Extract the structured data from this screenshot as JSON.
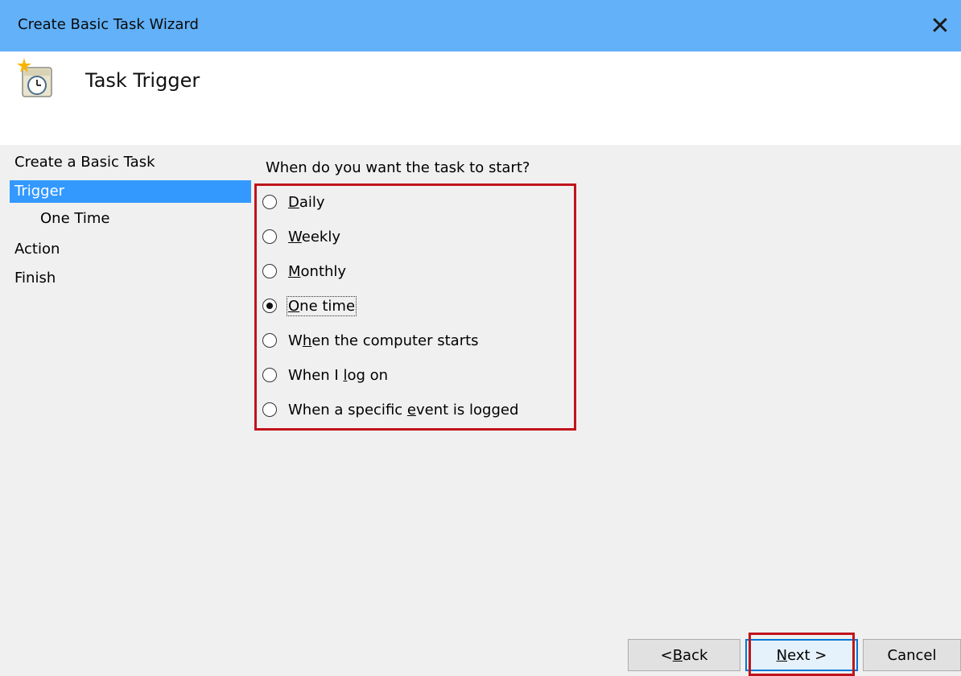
{
  "window": {
    "title": "Create Basic Task Wizard",
    "close_icon": "close-icon"
  },
  "header": {
    "icon": "scheduled-task-clock-icon",
    "title": "Task Trigger"
  },
  "nav": {
    "items": [
      {
        "label": "Create a Basic Task",
        "active": false,
        "sub": false
      },
      {
        "label": "Trigger",
        "active": true,
        "sub": false
      },
      {
        "label": "One Time",
        "active": false,
        "sub": true
      },
      {
        "label": "Action",
        "active": false,
        "sub": false
      },
      {
        "label": "Finish",
        "active": false,
        "sub": false
      }
    ]
  },
  "trigger": {
    "question": "When do you want the task to start?",
    "options": [
      {
        "pre": "",
        "key": "D",
        "post": "aily",
        "checked": false
      },
      {
        "pre": "",
        "key": "W",
        "post": "eekly",
        "checked": false
      },
      {
        "pre": "",
        "key": "M",
        "post": "onthly",
        "checked": false
      },
      {
        "pre": "",
        "key": "O",
        "post": "ne time",
        "checked": true
      },
      {
        "pre": "W",
        "key": "h",
        "post": "en the computer starts",
        "checked": false
      },
      {
        "pre": "When I ",
        "key": "l",
        "post": "og on",
        "checked": false
      },
      {
        "pre": "When a specific ",
        "key": "e",
        "post": "vent is logged",
        "checked": false
      }
    ],
    "highlight_color": "#c0141c"
  },
  "buttons": {
    "back": {
      "pre": "< ",
      "key": "B",
      "post": "ack"
    },
    "next": {
      "pre": "",
      "key": "N",
      "post": "ext >"
    },
    "cancel": "Cancel"
  },
  "colors": {
    "titlebar": "#62b1f9",
    "nav_active": "#3399ff",
    "background": "#f0f0f0"
  }
}
